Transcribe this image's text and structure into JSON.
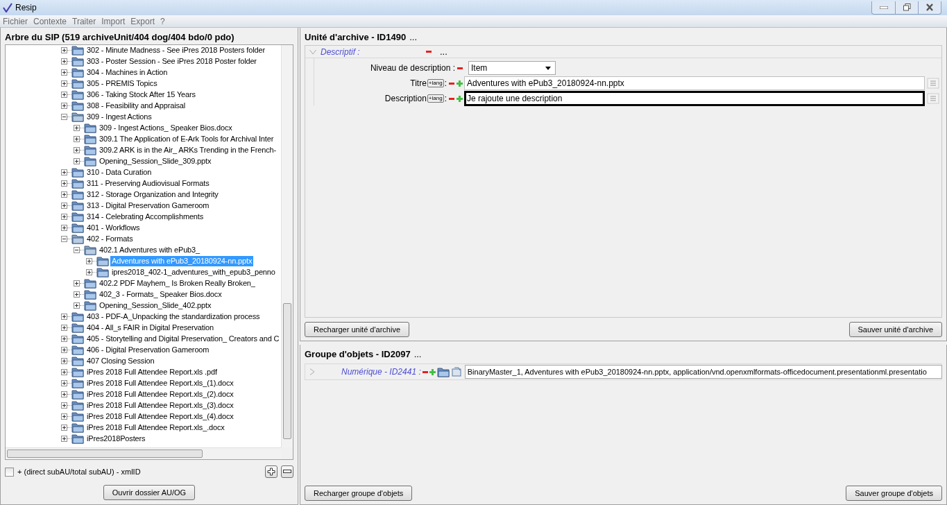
{
  "window": {
    "title": "Resip"
  },
  "menu": [
    "Fichier",
    "Contexte",
    "Traiter",
    "Import",
    "Export",
    "?"
  ],
  "tree_panel": {
    "title": "Arbre du SIP (519 archiveUnit/404 dog/404 bdo/0 pdo)",
    "items": [
      {
        "label": "302 - Minute Madness - See iPres 2018 Posters folder",
        "expanded": false,
        "selected": false
      },
      {
        "label": "303 - Poster Session - See iPres 2018 Poster folder",
        "expanded": false,
        "selected": false
      },
      {
        "label": "304 - Machines in Action",
        "expanded": false,
        "selected": false
      },
      {
        "label": "305 - PREMIS Topics",
        "expanded": false,
        "selected": false
      },
      {
        "label": "306 - Taking Stock After 15 Years",
        "expanded": false,
        "selected": false
      },
      {
        "label": "308 - Feasibility and Appraisal",
        "expanded": false,
        "selected": false
      },
      {
        "label": "309 - Ingest Actions",
        "expanded": true,
        "selected": false,
        "children": [
          {
            "label": "309 - Ingest Actions_ Speaker Bios.docx",
            "expanded": false,
            "selected": false
          },
          {
            "label": "309.1 The Application of E-Ark Tools for Archival Inter",
            "expanded": false,
            "selected": false
          },
          {
            "label": "309.2 ARK is in the Air_ ARKs Trending in the French-",
            "expanded": false,
            "selected": false
          },
          {
            "label": "Opening_Session_Slide_309.pptx",
            "expanded": false,
            "selected": false
          }
        ]
      },
      {
        "label": "310 - Data Curation",
        "expanded": false,
        "selected": false
      },
      {
        "label": "311 - Preserving Audiovisual Formats",
        "expanded": false,
        "selected": false
      },
      {
        "label": "312 - Storage Organization and Integrity",
        "expanded": false,
        "selected": false
      },
      {
        "label": "313 - Digital Preservation Gameroom",
        "expanded": false,
        "selected": false
      },
      {
        "label": "314 - Celebrating Accomplishments",
        "expanded": false,
        "selected": false
      },
      {
        "label": "401 - Workflows",
        "expanded": false,
        "selected": false
      },
      {
        "label": "402 - Formats",
        "expanded": true,
        "selected": false,
        "children": [
          {
            "label": "402.1 Adventures with ePub3_",
            "expanded": true,
            "selected": false,
            "children": [
              {
                "label": "Adventures with ePub3_20180924-nn.pptx",
                "expanded": false,
                "selected": true
              },
              {
                "label": "ipres2018_402-1_adventures_with_epub3_penno",
                "expanded": false,
                "selected": false
              }
            ]
          },
          {
            "label": "402.2 PDF Mayhem_ Is Broken Really Broken_",
            "expanded": false,
            "selected": false
          },
          {
            "label": "402_3 - Formats_ Speaker Bios.docx",
            "expanded": false,
            "selected": false
          },
          {
            "label": "Opening_Session_Slide_402.pptx",
            "expanded": false,
            "selected": false
          }
        ]
      },
      {
        "label": "403 - PDF-A_Unpacking the standardization process",
        "expanded": false,
        "selected": false
      },
      {
        "label": "404 - All_s FAIR in Digital Preservation",
        "expanded": false,
        "selected": false
      },
      {
        "label": "405 - Storytelling and Digital Preservation_ Creators and C",
        "expanded": false,
        "selected": false
      },
      {
        "label": "406 - Digital Preservation Gameroom",
        "expanded": false,
        "selected": false
      },
      {
        "label": "407 Closing Session",
        "expanded": false,
        "selected": false
      },
      {
        "label": "iPres 2018 Full Attendee Report.xls .pdf",
        "expanded": false,
        "selected": false
      },
      {
        "label": "iPres 2018 Full Attendee Report.xls_(1).docx",
        "expanded": false,
        "selected": false
      },
      {
        "label": "iPres 2018 Full Attendee Report.xls_(2).docx",
        "expanded": false,
        "selected": false
      },
      {
        "label": "iPres 2018 Full Attendee Report.xls_(3).docx",
        "expanded": false,
        "selected": false
      },
      {
        "label": "iPres 2018 Full Attendee Report.xls_(4).docx",
        "expanded": false,
        "selected": false
      },
      {
        "label": "iPres 2018 Full Attendee Report.xls_.docx",
        "expanded": false,
        "selected": false
      },
      {
        "label": "iPres2018Posters",
        "expanded": false,
        "selected": false
      }
    ],
    "option": {
      "label": "+ (direct subAU/total subAU) - xmlID",
      "checked": false
    },
    "open_button": "Ouvrir dossier AU/OG"
  },
  "archive_unit": {
    "title": "Unité d'archive - ID1490",
    "more": "...",
    "section": {
      "label": "Descriptif :",
      "expanded": true,
      "more": "...",
      "fields": [
        {
          "kind": "select",
          "label": "Niveau de description :",
          "value": "Item"
        },
        {
          "kind": "text",
          "label": "Titre",
          "lang": "+lang",
          "colon": ":",
          "value": "Adventures with ePub3_20180924-nn.pptx",
          "focused": false
        },
        {
          "kind": "text",
          "label": "Description",
          "lang": "+lang",
          "colon": ":",
          "value": "Je rajoute une description",
          "focused": true
        }
      ]
    },
    "buttons": [
      "Recharger unité d'archive",
      "Sauver unité d'archive"
    ]
  },
  "object_group": {
    "title": "Groupe d'objets - ID2097",
    "more": "...",
    "item": {
      "label": "Numérique - ID2441 :",
      "expanded": false,
      "value": "BinaryMaster_1, Adventures with ePub3_20180924-nn.pptx, application/vnd.openxmlformats-officedocument.presentationml.presentatio"
    },
    "buttons": [
      "Recharger groupe d'objets",
      "Sauver groupe d'objets"
    ]
  }
}
